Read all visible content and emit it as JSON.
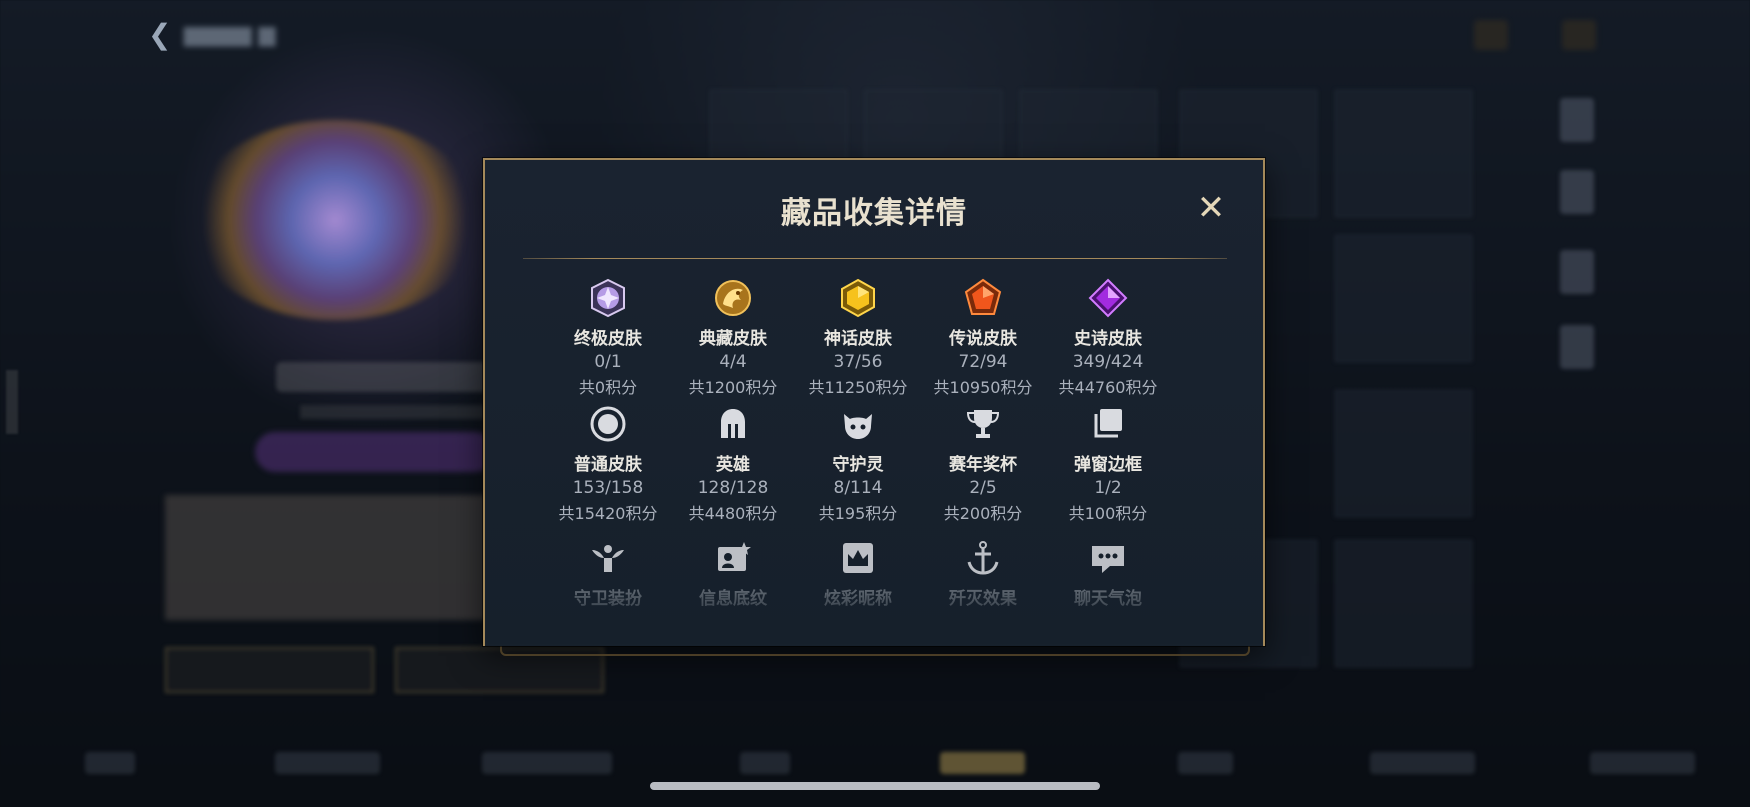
{
  "modal": {
    "title": "藏品收集详情",
    "close_label": "✕",
    "rows": [
      [
        {
          "name": "终极皮肤",
          "count": "0/1",
          "points": "共0积分",
          "icon": "ultimate-skin-gem-icon"
        },
        {
          "name": "典藏皮肤",
          "count": "4/4",
          "points": "共1200积分",
          "icon": "collection-skin-dragon-icon"
        },
        {
          "name": "神话皮肤",
          "count": "37/56",
          "points": "共11250积分",
          "icon": "mythic-skin-gem-icon"
        },
        {
          "name": "传说皮肤",
          "count": "72/94",
          "points": "共10950积分",
          "icon": "legend-skin-gem-icon"
        },
        {
          "name": "史诗皮肤",
          "count": "349/424",
          "points": "共44760积分",
          "icon": "epic-skin-gem-icon"
        }
      ],
      [
        {
          "name": "普通皮肤",
          "count": "153/158",
          "points": "共15420积分",
          "icon": "normal-skin-ring-icon"
        },
        {
          "name": "英雄",
          "count": "128/128",
          "points": "共4480积分",
          "icon": "hero-helmet-icon"
        },
        {
          "name": "守护灵",
          "count": "8/114",
          "points": "共195积分",
          "icon": "guardian-spirit-icon"
        },
        {
          "name": "赛年奖杯",
          "count": "2/5",
          "points": "共200积分",
          "icon": "trophy-icon"
        },
        {
          "name": "弹窗边框",
          "count": "1/2",
          "points": "共100积分",
          "icon": "popup-frame-icon"
        }
      ],
      [
        {
          "name": "守卫装扮",
          "icon": "guard-costume-icon"
        },
        {
          "name": "信息底纹",
          "icon": "info-background-icon"
        },
        {
          "name": "炫彩昵称",
          "icon": "colorful-nickname-icon"
        },
        {
          "name": "歼灭效果",
          "icon": "annihilation-effect-icon"
        },
        {
          "name": "聊天气泡",
          "icon": "chat-bubble-icon"
        }
      ]
    ]
  },
  "colors": {
    "accent_gold": "#a4895a",
    "title_text": "#e9e1cf",
    "muted_text": "#aab1bc"
  }
}
